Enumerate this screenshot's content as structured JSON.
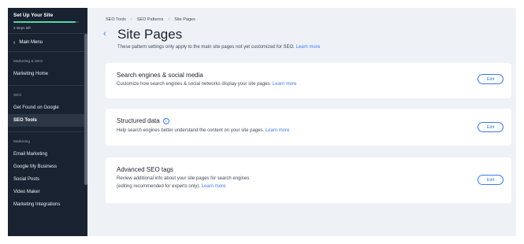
{
  "sidebar": {
    "setup_title": "Set Up Your Site",
    "setup_progress": 0.95,
    "setup_sub": "3 steps left",
    "main_menu": "Main Menu",
    "sections": [
      {
        "label": "Marketing & SEO",
        "items": [
          "Marketing Home"
        ]
      },
      {
        "label": "SEO",
        "items": [
          "Get Found on Google",
          "SEO Tools"
        ]
      },
      {
        "label": "Marketing",
        "items": [
          "Email Marketing",
          "Google My Business",
          "Social Posts",
          "Video Maker",
          "Marketing Integrations"
        ]
      }
    ],
    "active_item": "SEO Tools"
  },
  "breadcrumb": [
    "SEO Tools",
    "SEO Patterns",
    "Site Pages"
  ],
  "page": {
    "title": "Site Pages",
    "subtitle": "These pattern settings only apply to the main site pages not yet customized for SEO.",
    "subtitle_link": "Learn more"
  },
  "cards": [
    {
      "title": "Search engines & social media",
      "desc_1": "Customize how search engines & social networks display your site pages.",
      "desc_2": "",
      "link": "Learn more",
      "button": "Edit"
    },
    {
      "title": "Structured data",
      "info_icon": "i",
      "desc_1": "Help search engines better understand the content on your site pages.",
      "desc_2": "",
      "link": "Learn more",
      "button": "Edit"
    },
    {
      "title": "Advanced SEO tags",
      "desc_1": "Review additional info about your site pages for search engines",
      "desc_2": "(editing recommended for experts only).",
      "link": "Learn more",
      "button": "Edit"
    }
  ],
  "icons": {
    "back": "chevron-left-icon",
    "menu_back": "chevron-left-icon",
    "info": "info-icon"
  },
  "colors": {
    "sidebar_bg": "#182231",
    "accent": "#3b7ae8",
    "progress": "#56d6a6",
    "content_bg": "#eef2f7"
  }
}
